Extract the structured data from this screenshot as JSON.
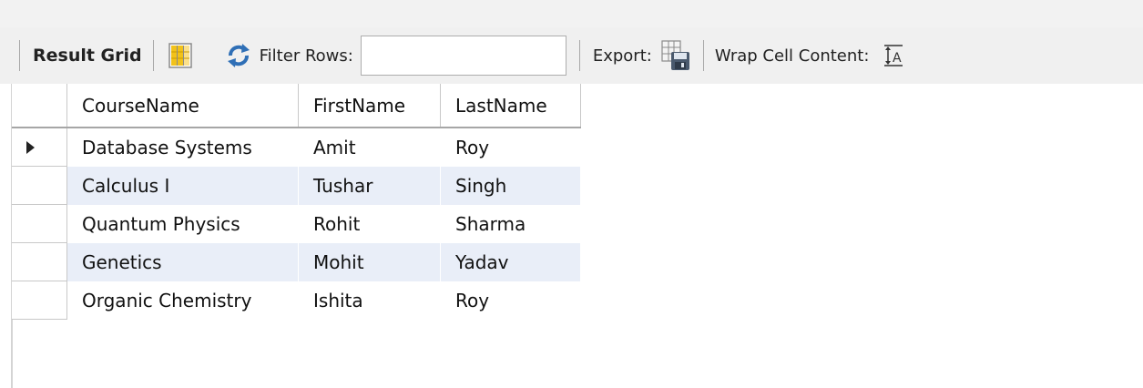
{
  "toolbar": {
    "result_grid_label": "Result Grid",
    "filter_rows_label": "Filter Rows:",
    "filter_rows_value": "",
    "export_label": "Export:",
    "wrap_cell_label": "Wrap Cell Content:",
    "icons": {
      "grid_icon": "grid-columns-icon",
      "refresh_icon": "refresh-icon",
      "export_icon": "export-save-icon",
      "wrap_icon": "wrap-text-icon"
    }
  },
  "grid": {
    "columns": [
      "CourseName",
      "FirstName",
      "LastName"
    ],
    "rows": [
      {
        "course": "Database Systems",
        "first": "Amit",
        "last": "Roy"
      },
      {
        "course": "Calculus I",
        "first": "Tushar",
        "last": "Singh"
      },
      {
        "course": "Quantum Physics",
        "first": "Rohit",
        "last": "Sharma"
      },
      {
        "course": "Genetics",
        "first": "Mohit",
        "last": "Yadav"
      },
      {
        "course": "Organic Chemistry",
        "first": "Ishita",
        "last": "Roy"
      }
    ],
    "selected_row": 0
  },
  "colors": {
    "alt_row": "#e9eef8",
    "toolbar_bg": "#f0f0f0",
    "refresh_blue": "#2f6fb6",
    "grid_icon_yellow": "#f2c21a"
  }
}
